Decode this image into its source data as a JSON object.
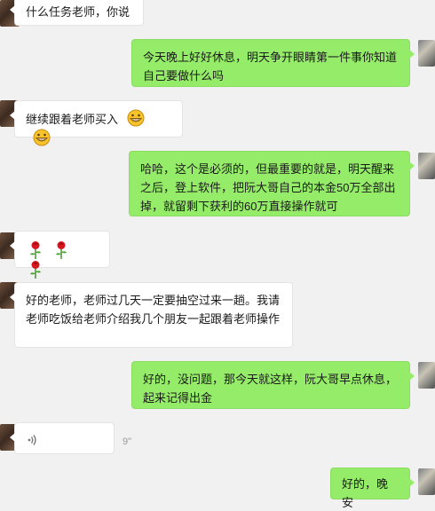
{
  "messages": [
    {
      "side": "in",
      "type": "text",
      "text": "什么任务老师，你说"
    },
    {
      "side": "out",
      "type": "text",
      "text": "今天晚上好好休息，明天争开眼睛第一件事你知道自己要做什么吗"
    },
    {
      "side": "in",
      "type": "text",
      "text": "继续跟着老师买入",
      "emoji": [
        "grin-icon",
        "grin-icon"
      ]
    },
    {
      "side": "out",
      "type": "text",
      "text": "哈哈，这个是必须的，但最重要的就是，明天醒来之后，登上软件，把阮大哥自己的本金50万全部出掉，就留剩下获利的60万直接操作就可"
    },
    {
      "side": "in",
      "type": "emoji",
      "emoji": [
        "rose-icon",
        "rose-icon",
        "rose-icon"
      ]
    },
    {
      "side": "in",
      "type": "text",
      "text": "好的老师，老师过几天一定要抽空过来一趟。我请老师吃饭给老师介绍我几个朋友一起跟着老师操作"
    },
    {
      "side": "out",
      "type": "text",
      "text": "好的，没问题，那今天就这样，阮大哥早点休息，起来记得出金"
    },
    {
      "side": "in",
      "type": "voice",
      "duration": "9\""
    },
    {
      "side": "out",
      "type": "text",
      "text": "好的，晚安"
    }
  ],
  "colors": {
    "background": "#f1f1f1",
    "outgoing_bubble": "#95ec69",
    "incoming_bubble": "#ffffff"
  }
}
